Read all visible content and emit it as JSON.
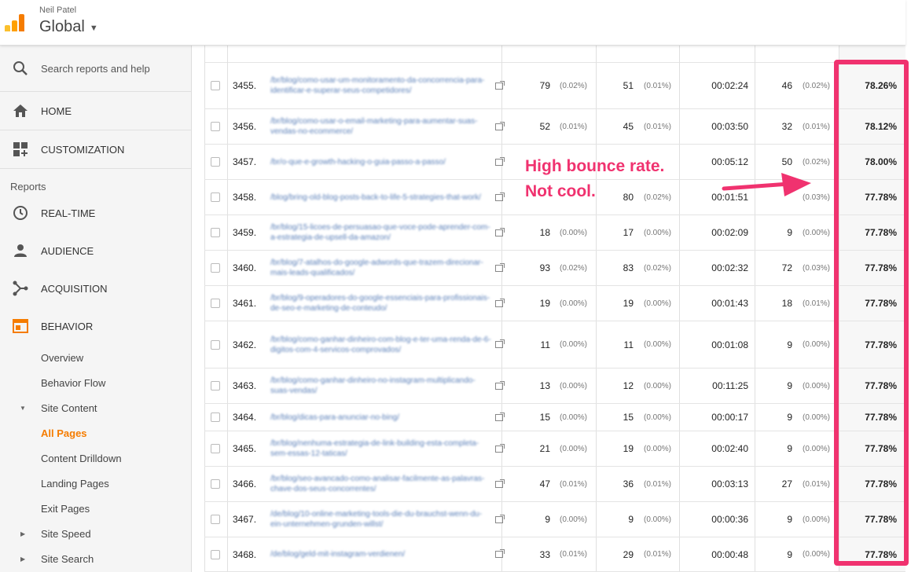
{
  "header": {
    "account_owner": "Neil Patel",
    "account_name": "Global",
    "brand_colors": [
      "#f57c00",
      "#ffa000",
      "#fbc02d"
    ]
  },
  "sidebar": {
    "search_placeholder": "Search reports and help",
    "home": "HOME",
    "customization": "CUSTOMIZATION",
    "reports_label": "Reports",
    "realtime": "REAL-TIME",
    "audience": "AUDIENCE",
    "acquisition": "ACQUISITION",
    "behavior": "BEHAVIOR",
    "behavior_items": [
      {
        "label": "Overview"
      },
      {
        "label": "Behavior Flow"
      },
      {
        "label": "Site Content"
      },
      {
        "label": "All Pages"
      },
      {
        "label": "Content Drilldown"
      },
      {
        "label": "Landing Pages"
      },
      {
        "label": "Exit Pages"
      },
      {
        "label": "Site Speed"
      },
      {
        "label": "Site Search"
      }
    ],
    "active_color": "#f57c00"
  },
  "table": {
    "rows": [
      {
        "idx": "3455.",
        "page": "/br/blog/como-usar-um-monitoramento-da-concorrencia-para-identificar-e-superar-seus-competidores/",
        "pv": "79",
        "pv_pct": "(0.02%)",
        "upv": "51",
        "upv_pct": "(0.01%)",
        "time": "00:02:24",
        "ent": "46",
        "ent_pct": "(0.02%)",
        "bounce": "78.26%"
      },
      {
        "idx": "3456.",
        "page": "/br/blog/como-usar-o-email-marketing-para-aumentar-suas-vendas-no-ecommerce/",
        "pv": "52",
        "pv_pct": "(0.01%)",
        "upv": "45",
        "upv_pct": "(0.01%)",
        "time": "00:03:50",
        "ent": "32",
        "ent_pct": "(0.01%)",
        "bounce": "78.12%"
      },
      {
        "idx": "3457.",
        "page": "/br/o-que-e-growth-hacking-o-guia-passo-a-passo/",
        "pv": "",
        "pv_pct": "",
        "upv": "",
        "upv_pct": "",
        "time": "00:05:12",
        "ent": "50",
        "ent_pct": "(0.02%)",
        "bounce": "78.00%"
      },
      {
        "idx": "3458.",
        "page": "/blog/bring-old-blog-posts-back-to-life-5-strategies-that-work/",
        "pv": "",
        "pv_pct": "",
        "upv": "80",
        "upv_pct": "(0.02%)",
        "time": "00:01:51",
        "ent": "",
        "ent_pct": "(0.03%)",
        "bounce": "77.78%"
      },
      {
        "idx": "3459.",
        "page": "/br/blog/15-licoes-de-persuasao-que-voce-pode-aprender-com-a-estrategia-de-upsell-da-amazon/",
        "pv": "18",
        "pv_pct": "(0.00%)",
        "upv": "17",
        "upv_pct": "(0.00%)",
        "time": "00:02:09",
        "ent": "9",
        "ent_pct": "(0.00%)",
        "bounce": "77.78%"
      },
      {
        "idx": "3460.",
        "page": "/br/blog/7-atalhos-do-google-adwords-que-trazem-direcionar-mais-leads-qualificados/",
        "pv": "93",
        "pv_pct": "(0.02%)",
        "upv": "83",
        "upv_pct": "(0.02%)",
        "time": "00:02:32",
        "ent": "72",
        "ent_pct": "(0.03%)",
        "bounce": "77.78%"
      },
      {
        "idx": "3461.",
        "page": "/br/blog/9-operadores-do-google-essenciais-para-profissionais-de-seo-e-marketing-de-conteudo/",
        "pv": "19",
        "pv_pct": "(0.00%)",
        "upv": "19",
        "upv_pct": "(0.00%)",
        "time": "00:01:43",
        "ent": "18",
        "ent_pct": "(0.01%)",
        "bounce": "77.78%"
      },
      {
        "idx": "3462.",
        "page": "/br/blog/como-ganhar-dinheiro-com-blog-e-ter-uma-renda-de-6-digitos-com-4-servicos-comprovados/",
        "pv": "11",
        "pv_pct": "(0.00%)",
        "upv": "11",
        "upv_pct": "(0.00%)",
        "time": "00:01:08",
        "ent": "9",
        "ent_pct": "(0.00%)",
        "bounce": "77.78%"
      },
      {
        "idx": "3463.",
        "page": "/br/blog/como-ganhar-dinheiro-no-instagram-multiplicando-suas-vendas/",
        "pv": "13",
        "pv_pct": "(0.00%)",
        "upv": "12",
        "upv_pct": "(0.00%)",
        "time": "00:11:25",
        "ent": "9",
        "ent_pct": "(0.00%)",
        "bounce": "77.78%"
      },
      {
        "idx": "3464.",
        "page": "/br/blog/dicas-para-anunciar-no-bing/",
        "pv": "15",
        "pv_pct": "(0.00%)",
        "upv": "15",
        "upv_pct": "(0.00%)",
        "time": "00:00:17",
        "ent": "9",
        "ent_pct": "(0.00%)",
        "bounce": "77.78%"
      },
      {
        "idx": "3465.",
        "page": "/br/blog/nenhuma-estrategia-de-link-building-esta-completa-sem-essas-12-taticas/",
        "pv": "21",
        "pv_pct": "(0.00%)",
        "upv": "19",
        "upv_pct": "(0.00%)",
        "time": "00:02:40",
        "ent": "9",
        "ent_pct": "(0.00%)",
        "bounce": "77.78%"
      },
      {
        "idx": "3466.",
        "page": "/br/blog/seo-avancado-como-analisar-facilmente-as-palavras-chave-dos-seus-concorrentes/",
        "pv": "47",
        "pv_pct": "(0.01%)",
        "upv": "36",
        "upv_pct": "(0.01%)",
        "time": "00:03:13",
        "ent": "27",
        "ent_pct": "(0.01%)",
        "bounce": "77.78%"
      },
      {
        "idx": "3467.",
        "page": "/de/blog/10-online-marketing-tools-die-du-brauchst-wenn-du-ein-unternehmen-grunden-willst/",
        "pv": "9",
        "pv_pct": "(0.00%)",
        "upv": "9",
        "upv_pct": "(0.00%)",
        "time": "00:00:36",
        "ent": "9",
        "ent_pct": "(0.00%)",
        "bounce": "77.78%"
      },
      {
        "idx": "3468.",
        "page": "/de/blog/geld-mit-instagram-verdienen/",
        "pv": "33",
        "pv_pct": "(0.01%)",
        "upv": "29",
        "upv_pct": "(0.01%)",
        "time": "00:00:48",
        "ent": "9",
        "ent_pct": "(0.00%)",
        "bounce": "77.78%"
      }
    ]
  },
  "annotation": {
    "line1": "High bounce rate.",
    "line2": "Not cool.",
    "color": "#f0326f"
  }
}
